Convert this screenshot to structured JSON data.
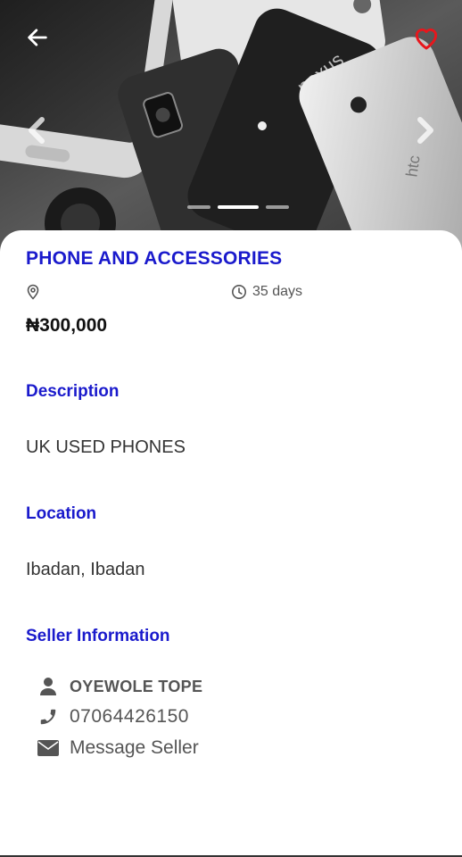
{
  "hero": {
    "image_alt": "phones collage",
    "slide_count": 3,
    "active_slide": 2,
    "icons": {
      "back": "arrow-left-icon",
      "favorite": "heart-outline-icon",
      "prev": "chevron-left-icon",
      "next": "chevron-right-icon"
    },
    "favorite_color": "#e8161c"
  },
  "listing": {
    "title": "PHONE AND ACCESSORIES",
    "location_icon": "map-pin-icon",
    "time_icon": "clock-icon",
    "age": "35 days",
    "price": "₦300,000"
  },
  "sections": {
    "description_label": "Description",
    "description_value": "UK USED PHONES",
    "location_label": "Location",
    "location_value": "Ibadan, Ibadan",
    "seller_label": "Seller Information"
  },
  "seller": {
    "name": "OYEWOLE TOPE",
    "phone": "07064426150",
    "message": "Message Seller",
    "icons": {
      "name": "user-icon",
      "phone": "phone-icon",
      "message": "envelope-icon"
    }
  },
  "colors": {
    "accent": "#1a1acc",
    "favorite": "#e8161c"
  }
}
